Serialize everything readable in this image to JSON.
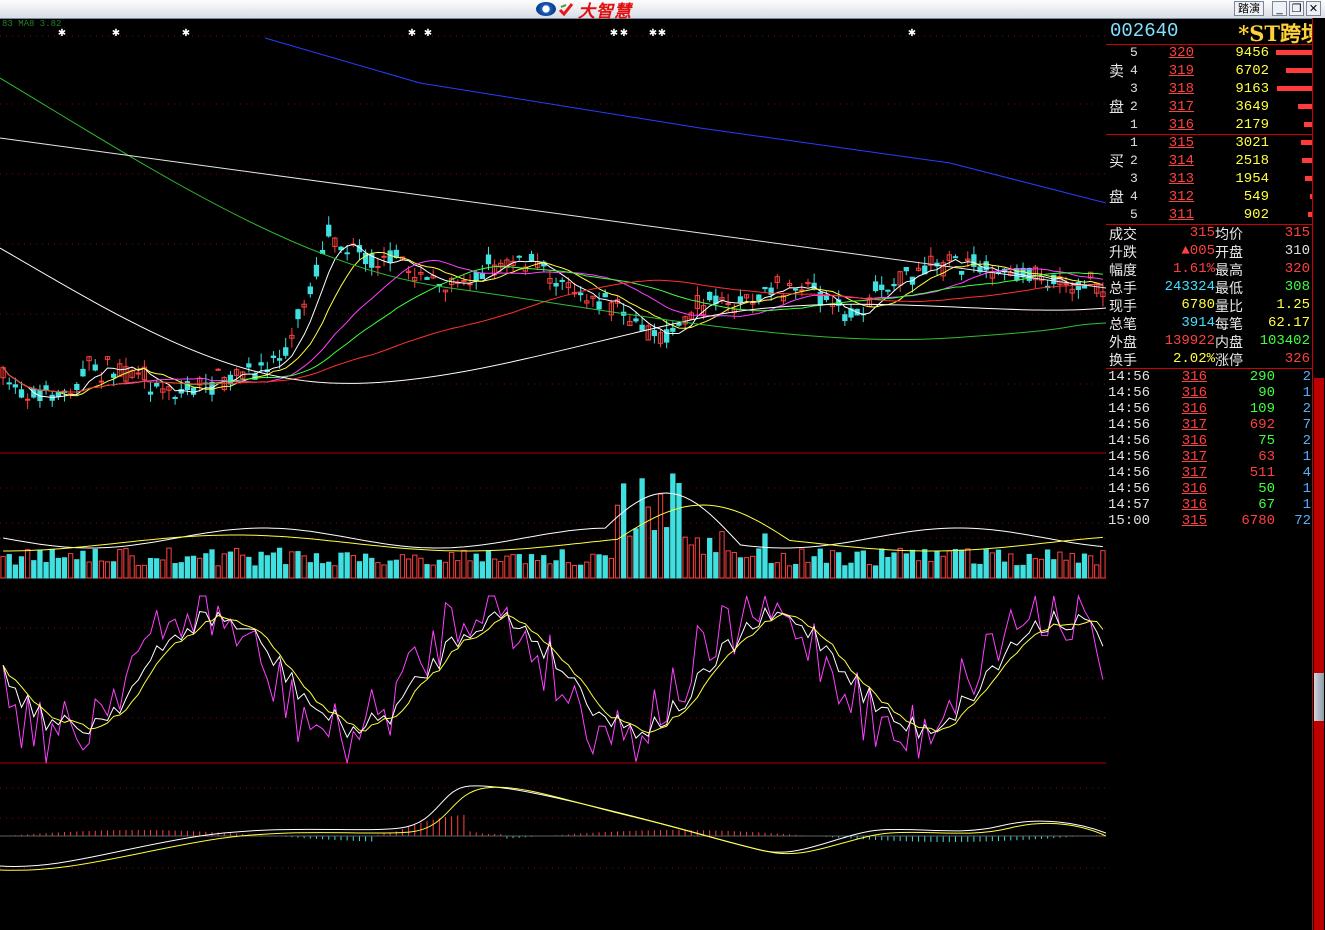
{
  "window": {
    "brand_name": "大智慧",
    "buttons": [
      "踏演",
      "_",
      "❐",
      "✕"
    ]
  },
  "indicator_label": "83 MA8 3.82",
  "stock": {
    "code": "002640",
    "name": "*ST跨境"
  },
  "order_book": {
    "sell_label_1": "卖",
    "sell_label_2": "盘",
    "buy_label_1": "买",
    "buy_label_2": "盘",
    "asks": [
      {
        "level": "5",
        "price": "320",
        "volume": "9456",
        "depth": 0.9
      },
      {
        "level": "4",
        "price": "319",
        "volume": "6702",
        "depth": 0.65
      },
      {
        "level": "3",
        "price": "318",
        "volume": "9163",
        "depth": 0.88
      },
      {
        "level": "2",
        "price": "317",
        "volume": "3649",
        "depth": 0.35
      },
      {
        "level": "1",
        "price": "316",
        "volume": "2179",
        "depth": 0.2
      }
    ],
    "bids": [
      {
        "level": "1",
        "price": "315",
        "volume": "3021",
        "depth": 0.28
      },
      {
        "level": "2",
        "price": "314",
        "volume": "2518",
        "depth": 0.24
      },
      {
        "level": "3",
        "price": "313",
        "volume": "1954",
        "depth": 0.18
      },
      {
        "level": "4",
        "price": "312",
        "volume": "549",
        "depth": 0.06
      },
      {
        "level": "5",
        "price": "311",
        "volume": "902",
        "depth": 0.09
      }
    ]
  },
  "stats": [
    {
      "l1": "成交",
      "v1": "315",
      "c1": "#ff4040",
      "l2": "均价",
      "v2": "315",
      "c2": "#ff4040"
    },
    {
      "l1": "升跌",
      "v1": "▲005",
      "c1": "#ff4040",
      "l2": "开盘",
      "v2": "310",
      "c2": "#e0e0e0"
    },
    {
      "l1": "幅度",
      "v1": "1.61%",
      "c1": "#ff4040",
      "l2": "最高",
      "v2": "320",
      "c2": "#ff4040"
    },
    {
      "l1": "总手",
      "v1": "243324",
      "c1": "#40e0ff",
      "l2": "最低",
      "v2": "308",
      "c2": "#40ff40"
    },
    {
      "l1": "现手",
      "v1": "6780",
      "c1": "#ffff40",
      "l2": "量比",
      "v2": "1.25",
      "c2": "#ffff40"
    },
    {
      "l1": "总笔",
      "v1": "3914",
      "c1": "#40e0ff",
      "l2": "每笔",
      "v2": "62.17",
      "c2": "#ffff40"
    },
    {
      "l1": "外盘",
      "v1": "139922",
      "c1": "#ff4040",
      "l2": "内盘",
      "v2": "103402",
      "c2": "#40ff40"
    },
    {
      "l1": "换手",
      "v1": "2.02%",
      "c1": "#ffff40",
      "l2": "涨停",
      "v2": "326",
      "c2": "#ff4040"
    }
  ],
  "ticks": [
    {
      "time": "14:56",
      "price": "316",
      "volume": "290",
      "volColor": "#40ff40",
      "count": "2"
    },
    {
      "time": "14:56",
      "price": "316",
      "volume": "90",
      "volColor": "#40ff40",
      "count": "1"
    },
    {
      "time": "14:56",
      "price": "316",
      "volume": "109",
      "volColor": "#40ff40",
      "count": "2"
    },
    {
      "time": "14:56",
      "price": "317",
      "volume": "692",
      "volColor": "#ff4040",
      "count": "7"
    },
    {
      "time": "14:56",
      "price": "316",
      "volume": "75",
      "volColor": "#40ff40",
      "count": "2"
    },
    {
      "time": "14:56",
      "price": "317",
      "volume": "63",
      "volColor": "#ff4040",
      "count": "1"
    },
    {
      "time": "14:56",
      "price": "317",
      "volume": "511",
      "volColor": "#ff4040",
      "count": "4"
    },
    {
      "time": "14:56",
      "price": "316",
      "volume": "50",
      "volColor": "#40ff40",
      "count": "1"
    },
    {
      "time": "14:57",
      "price": "316",
      "volume": "67",
      "volColor": "#40ff40",
      "count": "1"
    },
    {
      "time": "15:00",
      "price": "315",
      "volume": "6780",
      "volColor": "#ff4040",
      "count": "72"
    }
  ],
  "colors": {
    "up": "#ff4040",
    "down": "#40e0e0",
    "grid": "#a00000"
  },
  "icons": {
    "logo": "dazhihui-logo-icon",
    "markers": "star-marker-icon"
  }
}
